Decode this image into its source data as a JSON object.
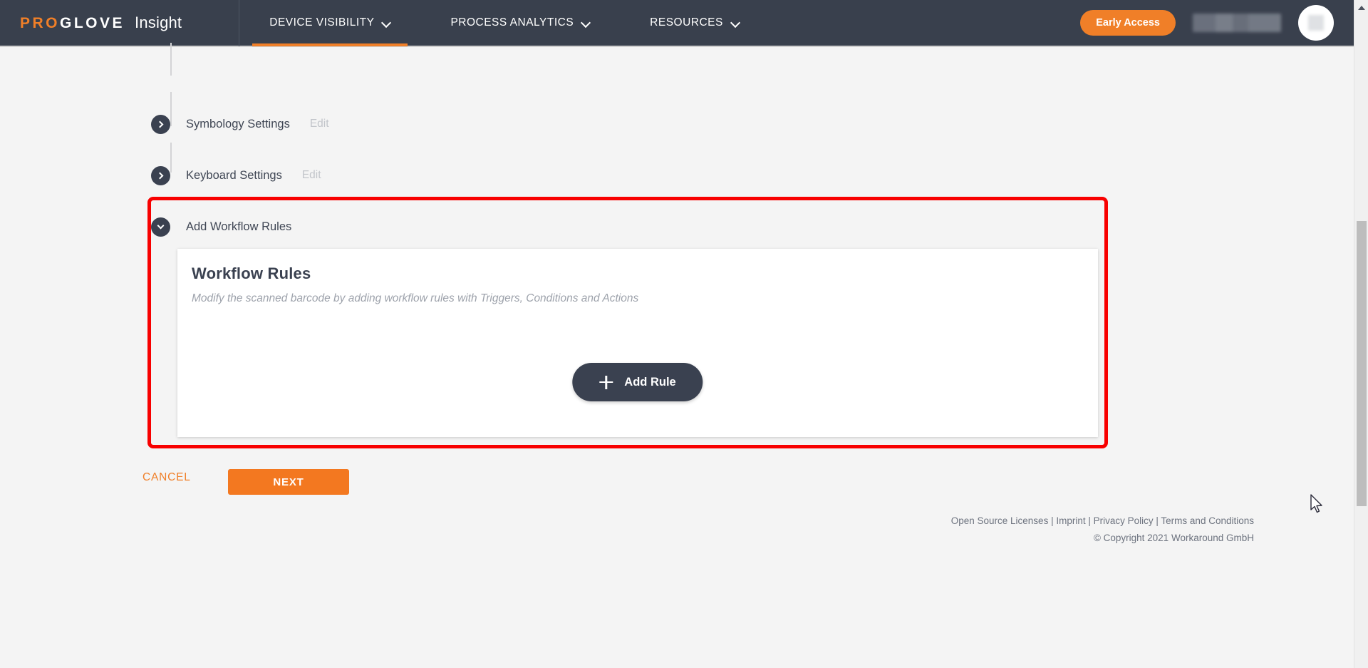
{
  "header": {
    "brand_pro": "PRO",
    "brand_glove": "GLOVE",
    "product": "Insight",
    "nav": [
      {
        "label": "DEVICE VISIBILITY",
        "icon": "chevron-down-icon",
        "active": true
      },
      {
        "label": "PROCESS ANALYTICS",
        "icon": "chevron-down-icon",
        "active": false
      },
      {
        "label": "RESOURCES",
        "icon": "chevron-down-icon",
        "active": false
      }
    ],
    "early_access_label": "Early Access",
    "user_name": "",
    "accent_color": "#f07f28",
    "bar_color": "#39404d"
  },
  "accordion": {
    "items": [
      {
        "label": "Symbology Settings",
        "edit_label": "Edit",
        "expanded": false,
        "icon": "chevron-right-icon"
      },
      {
        "label": "Keyboard Settings",
        "edit_label": "Edit",
        "expanded": false,
        "icon": "chevron-right-icon"
      },
      {
        "label": "Add Workflow Rules",
        "edit_label": "",
        "expanded": true,
        "icon": "chevron-down-icon"
      }
    ]
  },
  "workflow_card": {
    "title": "Workflow Rules",
    "subtitle": "Modify the scanned barcode by adding workflow rules with Triggers, Conditions and Actions",
    "add_rule_label": "Add Rule",
    "add_rule_icon": "plus-icon"
  },
  "actions": {
    "cancel_label": "CANCEL",
    "next_label": "NEXT"
  },
  "annotation": {
    "color": "#f80000",
    "target": "Add Workflow Rules section"
  },
  "footer": {
    "links": [
      "Open Source Licenses",
      "Imprint",
      "Privacy Policy",
      "Terms and Conditions"
    ],
    "separator": " | ",
    "copyright": "© Copyright 2021 Workaround GmbH"
  },
  "scrollbar": {
    "up_arrow_icon": "triangle-up-icon",
    "thumb_position": "middle"
  }
}
